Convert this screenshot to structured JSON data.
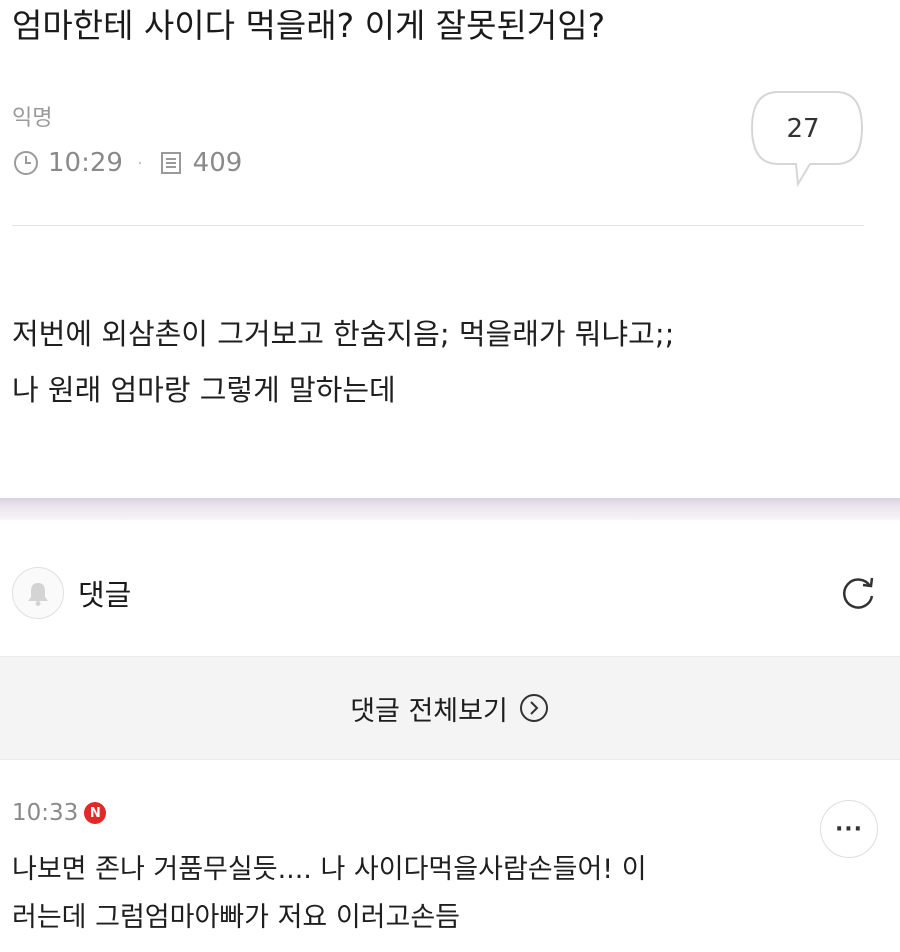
{
  "post": {
    "title": "엄마한테 사이다 먹을래? 이게 잘못된거임?",
    "author": "익명",
    "time": "10:29",
    "views": "409",
    "comment_count": "27",
    "body_lines": [
      "저번에 외삼촌이 그거보고 한숨지음; 먹을래가 뭐냐고;;",
      "나 원래 엄마랑 그렇게 말하는데"
    ]
  },
  "comments_section": {
    "label": "댓글",
    "view_all_label": "댓글 전체보기"
  },
  "comment": {
    "time": "10:33",
    "badge": "N",
    "more_label": "···",
    "lines": [
      "나보면 존나 거품무실듯.... 나 사이다먹을사람손들어! 이",
      "러는데 그럼엄마아빠가 저요 이러고손듬"
    ]
  },
  "icons": {
    "clock": "clock-icon",
    "views": "document-icon",
    "bubble": "speech-bubble-icon",
    "bell": "bell-icon",
    "refresh": "refresh-icon",
    "arrow": "circle-arrow-right-icon"
  },
  "colors": {
    "badge_red": "#e02a2a",
    "divider_band": "#e4dfe8",
    "view_all_bg": "#f4f4f4"
  }
}
